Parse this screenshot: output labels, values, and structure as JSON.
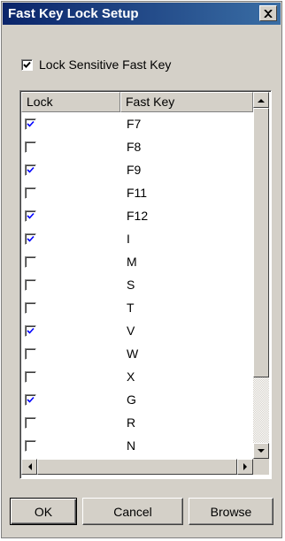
{
  "window": {
    "title": "Fast Key Lock Setup",
    "close_glyph": "✕"
  },
  "lock_sensitive": {
    "label": "Lock Sensitive Fast Key",
    "checked": true
  },
  "table": {
    "columns": [
      "Lock",
      "Fast Key"
    ],
    "rows": [
      {
        "lock": true,
        "key": "F7"
      },
      {
        "lock": false,
        "key": "F8"
      },
      {
        "lock": true,
        "key": "F9"
      },
      {
        "lock": false,
        "key": "F11"
      },
      {
        "lock": true,
        "key": "F12"
      },
      {
        "lock": true,
        "key": "I"
      },
      {
        "lock": false,
        "key": "M"
      },
      {
        "lock": false,
        "key": "S"
      },
      {
        "lock": false,
        "key": "T"
      },
      {
        "lock": true,
        "key": "V"
      },
      {
        "lock": false,
        "key": "W"
      },
      {
        "lock": false,
        "key": "X"
      },
      {
        "lock": true,
        "key": "G"
      },
      {
        "lock": false,
        "key": "R"
      },
      {
        "lock": false,
        "key": "N"
      }
    ]
  },
  "buttons": {
    "ok": "OK",
    "cancel": "Cancel",
    "browse": "Browse"
  },
  "colors": {
    "title_bar": "#0a246a",
    "check_mark_list": "#0000ff",
    "check_mark_main": "#000000",
    "face": "#d4d0c8"
  },
  "icons": [
    "close-icon",
    "check-icon",
    "scroll-up-icon",
    "scroll-down-icon",
    "scroll-left-icon",
    "scroll-right-icon"
  ]
}
